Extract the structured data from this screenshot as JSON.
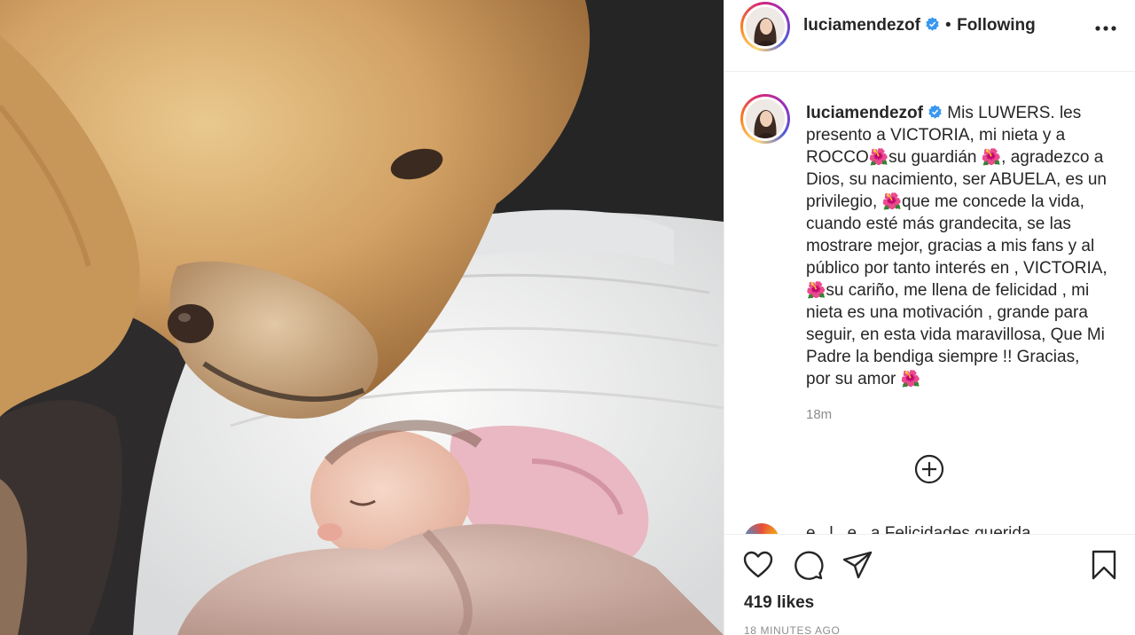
{
  "post": {
    "username": "luciamendezof",
    "verified": true,
    "separator": "•",
    "follow_status": "Following",
    "more_icon": "more-options-icon",
    "caption_segments": [
      "Mis LUWERS. les presento a VICTORIA, mi nieta y a ROCCO",
      "🌺",
      "su guardián ",
      "🌺",
      ", agradezco a Dios, su nacimiento, ser ABUELA, es un privilegio, ",
      "🌺",
      "que me concede la vida, cuando esté más grandecita, se las mostrare mejor, gracias a mis fans y al público por tanto interés en , VICTORIA, ",
      "🌺",
      "su cariño, me llena de felicidad , mi nieta es una motivación , grande para seguir, en esta vida maravillosa, Que Mi Padre la bendiga siempre !! Gracias, por su amor ",
      "🌺"
    ],
    "caption_time": "18m",
    "next_comment_partial": "e...l...e...a   Felicidades querida",
    "likes": "419 likes",
    "time_ago": "18 MINUTES AGO"
  },
  "icons": {
    "load_more": "plus-circle-icon",
    "like": "heart-icon",
    "comment": "comment-bubble-icon",
    "share": "paper-plane-icon",
    "save": "bookmark-icon",
    "verified": "verified-badge-icon"
  },
  "colors": {
    "text": "#262626",
    "secondary": "#8e8e8e",
    "verified": "#3897f0",
    "divider": "#efefef"
  }
}
